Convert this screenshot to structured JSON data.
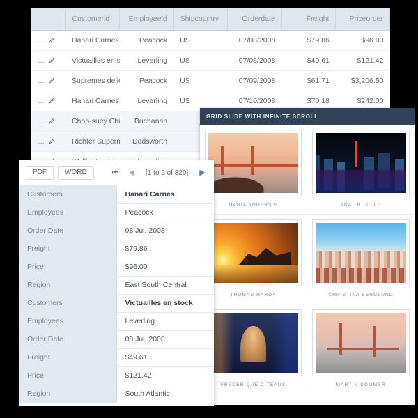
{
  "top_grid": {
    "name": "orders-grid",
    "columns": [
      {
        "key": "cmd",
        "label": "",
        "align": "left"
      },
      {
        "key": "customerid",
        "label": "Customerid",
        "align": "left"
      },
      {
        "key": "employeeid",
        "label": "Employeeid",
        "align": "right"
      },
      {
        "key": "shipcountry",
        "label": "Shipcountry",
        "align": "left"
      },
      {
        "key": "orderdate",
        "label": "Orderdate",
        "align": "right"
      },
      {
        "key": "freight",
        "label": "Freight",
        "align": "right"
      },
      {
        "key": "priceorder",
        "label": "Priceorder",
        "align": "right"
      }
    ],
    "row_icons": {
      "more": "…",
      "edit": "pencil-icon"
    },
    "rows": [
      {
        "customerid": "Hanari Carnes",
        "employeeid": "Peacock",
        "shipcountry": "US",
        "orderdate": "07/08/2008",
        "freight": "$79.86",
        "priceorder": "$96.00",
        "alt": false
      },
      {
        "customerid": "Victuailles en stock",
        "employeeid": "Leverling",
        "shipcountry": "US",
        "orderdate": "07/08/2008",
        "freight": "$49.61",
        "priceorder": "$121.42",
        "alt": false
      },
      {
        "customerid": "Supremes delices",
        "employeeid": "Peacock",
        "shipcountry": "US",
        "orderdate": "07/09/2008",
        "freight": "$61.71",
        "priceorder": "$3,206.50",
        "alt": false
      },
      {
        "customerid": "Hanari Carnes",
        "employeeid": "Leverling",
        "shipcountry": "US",
        "orderdate": "07/10/2008",
        "freight": "$70.18",
        "priceorder": "$242.00",
        "alt": false
      },
      {
        "customerid": "Chop-suey Chinese",
        "employeeid": "Buchanan",
        "shipcountry": "",
        "orderdate": "",
        "freight": "",
        "priceorder": "",
        "alt": true
      },
      {
        "customerid": "Richter Supermarkt",
        "employeeid": "Dodsworth",
        "shipcountry": "",
        "orderdate": "",
        "freight": "",
        "priceorder": "",
        "alt": true
      },
      {
        "customerid": "Wellington Importadora",
        "employeeid": "Leverling",
        "shipcountry": "",
        "orderdate": "",
        "freight": "",
        "priceorder": "",
        "alt": false
      }
    ]
  },
  "slide_panel": {
    "title": "GRID SLIDE WITH INFINITE SCROLL",
    "accent": "#334256",
    "cards": [
      {
        "caption": "MARIA ANDERS S",
        "art": "ph-ggb1",
        "alt": "golden-gate-bridge-sunset-photo"
      },
      {
        "caption": "ANA TRUJILLO",
        "art": "ph-night",
        "alt": "toronto-skyline-night-photo"
      },
      {
        "caption": "THOMAS HARDY",
        "art": "ph-sunset",
        "alt": "rio-beach-sunset-photo"
      },
      {
        "caption": "CHRISTINA BERGLUND",
        "art": "ph-city",
        "alt": "city-rooftops-photo"
      },
      {
        "caption": "FREDERIQUE CITEAUX",
        "art": "ph-dome",
        "alt": "budapest-basilica-night-photo"
      },
      {
        "caption": "MARTIN SOMMER",
        "art": "ph-ggb2",
        "alt": "golden-gate-bridge-dusk-photo"
      }
    ]
  },
  "detail_panel": {
    "toolbar": {
      "pdf_label": "PDF",
      "word_label": "WORD",
      "first_icon": "first-page-icon",
      "prev_icon": "previous-page-icon",
      "next_icon": "next-page-icon",
      "last_icon": "last-page-icon",
      "page_info": "[1 to 2 of 829]"
    },
    "records": [
      {
        "fields": [
          {
            "label": "Customers",
            "value": "Hanari Carnes",
            "strong": true
          },
          {
            "label": "Employees",
            "value": "Peacock",
            "strong": false
          },
          {
            "label": "Order Date",
            "value": "08 Jul, 2008",
            "strong": false
          },
          {
            "label": "Freight",
            "value": "$79.86",
            "strong": false
          },
          {
            "label": "Price",
            "value": "$96.00",
            "strong": false
          },
          {
            "label": "Region",
            "value": "East South Central",
            "strong": false
          }
        ]
      },
      {
        "fields": [
          {
            "label": "Customers",
            "value": "Victuailles en stock",
            "strong": true
          },
          {
            "label": "Employees",
            "value": "Leverling",
            "strong": false
          },
          {
            "label": "Order Date",
            "value": "08 Jul, 2008",
            "strong": false
          },
          {
            "label": "Freight",
            "value": "$49.61",
            "strong": false
          },
          {
            "label": "Price",
            "value": "$121.42",
            "strong": false
          },
          {
            "label": "Region",
            "value": "South Atlantic",
            "strong": false
          }
        ]
      }
    ]
  }
}
